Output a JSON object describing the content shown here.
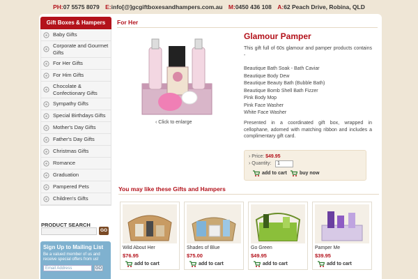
{
  "contact": {
    "phone_key": "PH:",
    "phone": "07 5575 8079",
    "email_key": "E:",
    "email": "info[@]gcgiftboxesandhampers.com.au",
    "mobile_key": "M:",
    "mobile": "0450 436 108",
    "address_key": "A:",
    "address": "62 Peach Drive, Robina, QLD"
  },
  "sidebar": {
    "heading": "Gift Boxes & Hampers",
    "items": [
      {
        "label": "Baby Gifts"
      },
      {
        "label": "Corporate and Gourmet Gifts"
      },
      {
        "label": "For Her Gifts"
      },
      {
        "label": "For Him Gifts"
      },
      {
        "label": "Chocolate & Confectionary Gifts"
      },
      {
        "label": "Sympathy Gifts"
      },
      {
        "label": "Special Birthdays Gifts"
      },
      {
        "label": "Mother's Day Gifts"
      },
      {
        "label": "Father's Day Gifts"
      },
      {
        "label": "Christmas Gifts"
      },
      {
        "label": "Romance"
      },
      {
        "label": "Graduation"
      },
      {
        "label": "Pampered Pets"
      },
      {
        "label": "Children's Gifts"
      }
    ],
    "search_title": "PRODUCT SEARCH",
    "search_go": "GO",
    "mailing_title": "Sign Up to Mailing List",
    "mailing_text": "Be a valued member of us and receive special offers from us!",
    "mailing_placeholder": "Email Address",
    "mailing_go": "GO"
  },
  "main": {
    "breadcrumb": "For Her",
    "product": {
      "name": "Glamour Pamper",
      "intro": "This gift full of 60s glamour and pamper products contains -",
      "items": [
        "Beautique Bath Soak - Bath Caviar",
        "Beautique Body Dew",
        "Beautique Beauty Bath (Bubble Bath)",
        "Beautique Bomb Shell Bath Fizzer",
        "Pink Body Mop",
        "Pink Face Washer",
        "White Face Washer"
      ],
      "description": "Presented in a coordinated gift box, wrapped in cellophane, adorned with matching ribbon and includes a complimentary gift card.",
      "enlarge": "‹ Click to enlarge",
      "price_label": "Price:",
      "price": "$49.95",
      "quantity_label": "Quantity:",
      "quantity": "1",
      "add_to_cart": "add to cart",
      "buy_now": "buy now"
    },
    "related_title": "You may like these Gifts and Hampers",
    "related": [
      {
        "name": "Wild About Her",
        "price": "$76.95",
        "add": "add to cart"
      },
      {
        "name": "Shades of Blue",
        "price": "$75.00",
        "add": "add to cart"
      },
      {
        "name": "Go Green",
        "price": "$49.95",
        "add": "add to cart"
      },
      {
        "name": "Pamper Me",
        "price": "$39.95",
        "add": "add to cart"
      }
    ]
  },
  "colors": {
    "brand_red": "#b3121b",
    "page_bg": "#efe6d6",
    "mailing_blue": "#7fb1cf"
  }
}
